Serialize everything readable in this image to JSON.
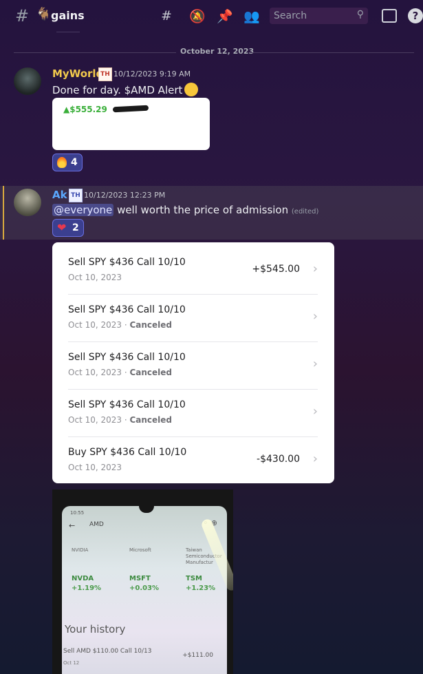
{
  "header": {
    "channel_name": "gains",
    "channel_emoji": "🐐",
    "search_placeholder": "Search",
    "help_label": "?"
  },
  "divider": {
    "date": "October 12, 2023"
  },
  "messages": [
    {
      "username": "MyWorld",
      "username_color": "#f2c94c",
      "badge": "TH",
      "timestamp": "10/12/2023 9:19 AM",
      "text": "Done for day. $AMD Alert",
      "embed_price": "▲$555.29",
      "reaction": {
        "emoji": "fire",
        "count": "4"
      }
    },
    {
      "username": "Ak",
      "username_color": "#5aa8ff",
      "badge": "TH",
      "timestamp": "10/12/2023 12:23 PM",
      "mention": "@everyone",
      "text": " well worth the price of admission ",
      "edited": "(edited)",
      "reaction": {
        "emoji": "heart",
        "count": "2"
      }
    }
  ],
  "transactions": [
    {
      "title": "Sell SPY $436 Call 10/10",
      "date": "Oct 10, 2023",
      "status": "",
      "amount": "+$545.00"
    },
    {
      "title": "Sell SPY $436 Call 10/10",
      "date": "Oct 10, 2023",
      "status": "Canceled",
      "amount": ""
    },
    {
      "title": "Sell SPY $436 Call 10/10",
      "date": "Oct 10, 2023",
      "status": "Canceled",
      "amount": ""
    },
    {
      "title": "Sell SPY $436 Call 10/10",
      "date": "Oct 10, 2023",
      "status": "Canceled",
      "amount": ""
    },
    {
      "title": "Buy SPY $436 Call 10/10",
      "date": "Oct 10, 2023",
      "status": "",
      "amount": "-$430.00"
    }
  ],
  "phone": {
    "time": "10:55",
    "title": "AMD",
    "stocks": [
      {
        "name": "NVIDIA",
        "ticker": "NVDA",
        "change": "+1.19%"
      },
      {
        "name": "Microsoft",
        "ticker": "MSFT",
        "change": "+0.03%"
      },
      {
        "name": "Taiwan Semiconductor Manufactur",
        "ticker": "TSM",
        "change": "+1.23%"
      }
    ],
    "history_title": "Your history",
    "history_row": "Sell AMD $110.00 Call 10/13",
    "history_amount": "+$111.00",
    "history_date": "Oct 12"
  }
}
